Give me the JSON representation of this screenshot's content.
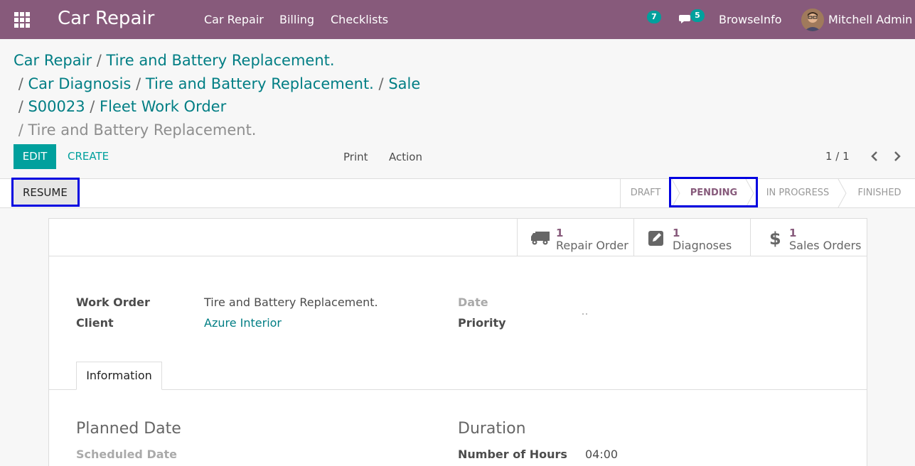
{
  "navbar": {
    "brand": "Car Repair",
    "menu": [
      "Car Repair",
      "Billing",
      "Checklists"
    ],
    "activity_count": "7",
    "message_count": "5",
    "company": "BrowseInfo",
    "user": "Mitchell Admin"
  },
  "breadcrumb": {
    "items": [
      "Car Repair",
      "Tire and Battery Replacement.",
      "Car Diagnosis",
      "Tire and Battery Replacement.",
      "Sale",
      "S00023",
      "Fleet Work Order"
    ],
    "separator": "/",
    "current": "Tire and Battery Replacement."
  },
  "controls": {
    "edit": "EDIT",
    "create": "CREATE",
    "print": "Print",
    "action": "Action",
    "pager": "1 / 1"
  },
  "statusbar": {
    "resume": "RESUME",
    "stages": [
      "DRAFT",
      "PENDING",
      "IN PROGRESS",
      "FINISHED"
    ],
    "active_stage": "PENDING"
  },
  "smart_buttons": [
    {
      "value": "1",
      "label": "Repair Order",
      "icon": "truck-icon"
    },
    {
      "value": "1",
      "label": "Diagnoses",
      "icon": "pencil-square-icon"
    },
    {
      "value": "1",
      "label": "Sales Orders",
      "icon": "dollar-icon"
    }
  ],
  "fields": {
    "work_order_label": "Work Order",
    "work_order_value": "Tire and Battery Replacement.",
    "client_label": "Client",
    "client_value": "Azure Interior",
    "date_label": "Date",
    "priority_label": "Priority"
  },
  "tabs": [
    "Information"
  ],
  "info": {
    "planned_date_title": "Planned Date",
    "scheduled_date_label": "Scheduled Date",
    "duration_title": "Duration",
    "hours_label": "Number of Hours",
    "hours_value": "04:00"
  },
  "colors": {
    "brand": "#875a7b",
    "accent": "#00a09d",
    "link": "#017e84",
    "highlight_border": "#0000e0"
  }
}
